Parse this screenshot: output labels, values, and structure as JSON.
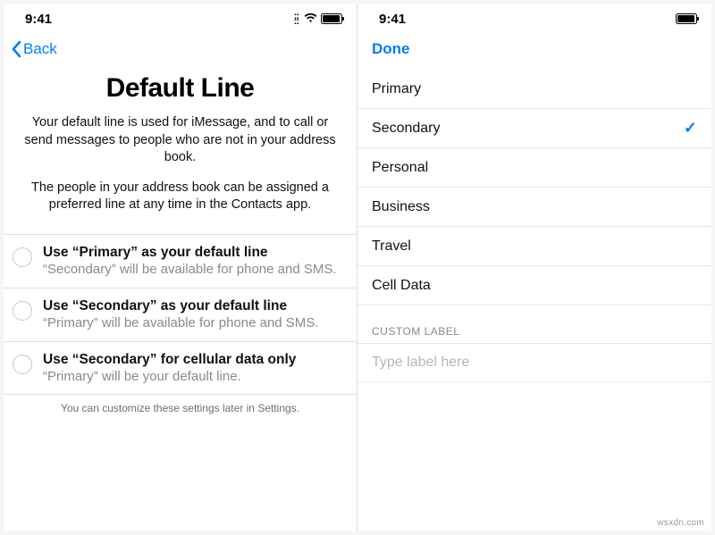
{
  "status": {
    "time": "9:41"
  },
  "left": {
    "back_label": "Back",
    "title": "Default Line",
    "desc1": "Your default line is used for iMessage, and to call or send messages to people who are not in your address book.",
    "desc2": "The people in your address book can be assigned a preferred line at any time in the Contacts app.",
    "options": [
      {
        "title": "Use “Primary” as your default line",
        "sub": "“Secondary” will be available for phone and SMS."
      },
      {
        "title": "Use “Secondary” as your default line",
        "sub": "“Primary” will be available for phone and SMS."
      },
      {
        "title": "Use “Secondary” for cellular data only",
        "sub": "“Primary” will be your default line."
      }
    ],
    "footnote": "You can customize these settings later in Settings."
  },
  "right": {
    "done_label": "Done",
    "items": [
      {
        "label": "Primary",
        "selected": false
      },
      {
        "label": "Secondary",
        "selected": true
      },
      {
        "label": "Personal",
        "selected": false
      },
      {
        "label": "Business",
        "selected": false
      },
      {
        "label": "Travel",
        "selected": false
      },
      {
        "label": "Cell Data",
        "selected": false
      }
    ],
    "custom_section": "CUSTOM LABEL",
    "custom_placeholder": "Type label here"
  },
  "watermark": "wsxdn.com"
}
